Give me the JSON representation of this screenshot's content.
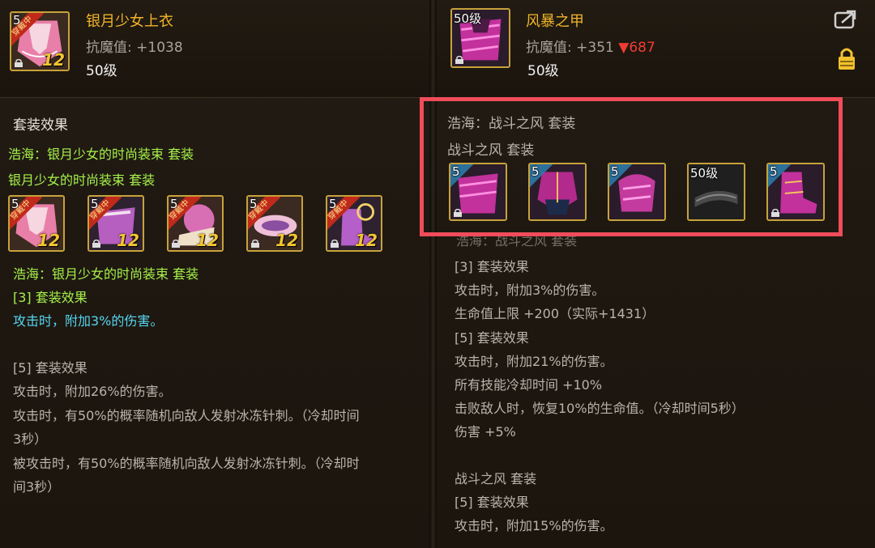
{
  "left": {
    "item": {
      "icon": "silver-moon-top-icon",
      "level_badge": "5",
      "ribbon": "穿戴中",
      "enhance": "12",
      "name": "银月少女上衣",
      "stat_label": "抗魔值:",
      "stat_value": "+1038",
      "level": "50级"
    },
    "section_title": "套装效果",
    "set_owner_line": "浩海：银月少女的时尚装束 套装",
    "set_name": "银月少女的时尚装束 套装",
    "set_items": [
      {
        "icon": "silver-moon-top-icon",
        "badge": "5",
        "ribbon": "穿戴中",
        "enhance": "12"
      },
      {
        "icon": "silver-moon-bottom-icon",
        "badge": "5",
        "ribbon": "穿戴中",
        "enhance": "12"
      },
      {
        "icon": "silver-moon-shoulder-icon",
        "badge": "5",
        "ribbon": "穿戴中",
        "enhance": "12"
      },
      {
        "icon": "silver-moon-belt-icon",
        "badge": "5",
        "ribbon": "穿戴中",
        "enhance": "12"
      },
      {
        "icon": "silver-moon-shoes-icon",
        "badge": "5",
        "ribbon": "穿戴中",
        "enhance": "12"
      }
    ],
    "set_owner_line2": "浩海：银月少女的时尚装束 套装",
    "effect3_title": "[3] 套装效果",
    "effect3_line1": "攻击时，附加3%的伤害。",
    "effect5_title": "[5] 套装效果",
    "effect5_line1": "攻击时，附加26%的伤害。",
    "effect5_line2": "攻击时，有50%的概率随机向敌人发射冰冻针刺。（冷却时间",
    "effect5_line3": "3秒）",
    "effect5_line4": "被攻击时，有50%的概率随机向敌人发射冰冻针刺。（冷却时",
    "effect5_line5": "间3秒）"
  },
  "right": {
    "item": {
      "icon": "storm-armor-icon",
      "level_badge": "50级",
      "name": "风暴之甲",
      "stat_label": "抗魔值:",
      "stat_value": "+351",
      "stat_diff": "▼687",
      "level": "50级"
    },
    "share_icon": "share-icon",
    "lock_icon": "lock-icon",
    "set_owner_line": "浩海：战斗之风 套装",
    "set_name": "战斗之风 套装",
    "set_items": [
      {
        "icon": "storm-armor-icon",
        "badge": "5"
      },
      {
        "icon": "storm-top-icon",
        "badge": "5"
      },
      {
        "icon": "storm-shoulder-icon",
        "badge": "5"
      },
      {
        "icon": "storm-belt-icon",
        "badge": "50级"
      },
      {
        "icon": "storm-shoes-icon",
        "badge": "5"
      }
    ],
    "partial_line": "浩海：战斗之风 套装",
    "effect3_title": "[3] 套装效果",
    "effect3_line1": "攻击时，附加3%的伤害。",
    "effect3_line2": "生命值上限 +200（实际+1431）",
    "effect5_title": "[5] 套装效果",
    "effect5_line1": "攻击时，附加21%的伤害。",
    "effect5_line2": "所有技能冷却时间 +10%",
    "effect5_line3": "击败敌人时，恢复10%的生命值。（冷却时间5秒）",
    "effect5_line4": "伤害 +5%",
    "set2_name": "战斗之风 套装",
    "set2_effect_title": "[5] 套装效果",
    "set2_effect_line1": "攻击时，附加15%的伤害。"
  },
  "colors": {
    "highlight": "#f04c5a",
    "gold": "#f0b429",
    "green": "#a6f04a",
    "blue": "#56d6f0",
    "red": "#f03c32"
  }
}
